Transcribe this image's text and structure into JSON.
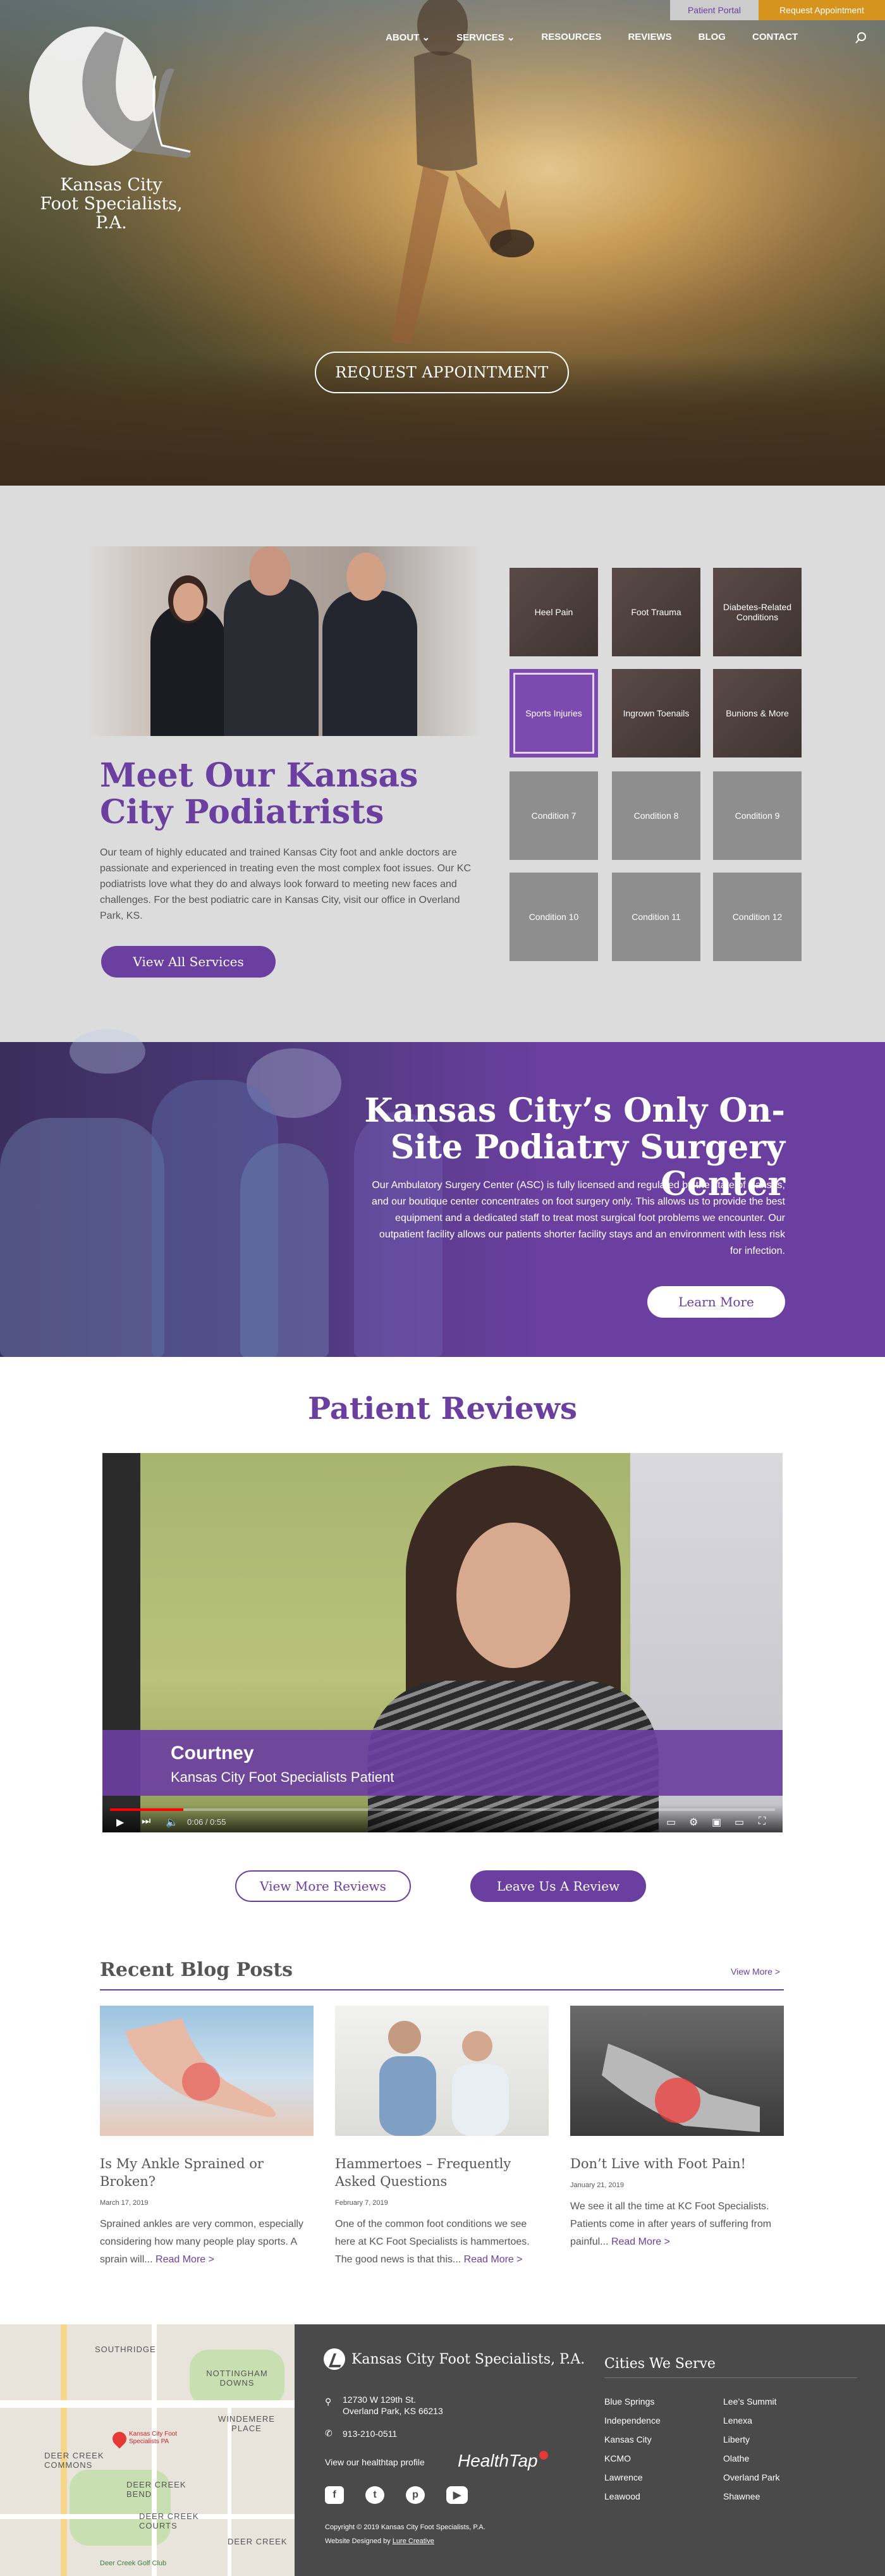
{
  "header": {
    "patient_portal": "Patient Portal",
    "request_appointment": "Request Appointment",
    "nav": [
      "ABOUT",
      "SERVICES",
      "RESOURCES",
      "REVIEWS",
      "BLOG",
      "CONTACT"
    ],
    "logo_line1": "Kansas City",
    "logo_line2": "Foot Specialists, P.A."
  },
  "hero": {
    "cta": "REQUEST APPOINTMENT"
  },
  "meet": {
    "title": "Meet Our Kansas City Podiatrists",
    "text": "Our team of highly educated and trained Kansas City foot and ankle doctors are passionate and experienced in treating even the most complex foot issues. Our KC podiatrists love what they do and always look forward to meeting new faces and challenges. For the best podiatric care in Kansas City, visit our office in Overland Park, KS.",
    "button": "View All Services",
    "conditions": [
      "Heel Pain",
      "Foot Trauma",
      "Diabetes-Related Conditions",
      "Sports Injuries",
      "Ingrown Toenails",
      "Bunions & More",
      "Condition 7",
      "Condition 8",
      "Condition 9",
      "Condition 10",
      "Condition 11",
      "Condition 12"
    ]
  },
  "surgery": {
    "title": "Kansas City’s Only On-Site Podiatry Surgery Center",
    "text": "Our Ambulatory Surgery Center (ASC) is fully licensed and regulated by the state of Kansas, and our boutique center concentrates on foot surgery only. This allows us to provide the best equipment and a dedicated staff to treat most surgical foot problems we encounter. Our outpatient facility allows our patients shorter facility stays and an environment with less risk for infection.",
    "button": "Learn More"
  },
  "reviews": {
    "title": "Patient Reviews",
    "video_name": "Courtney",
    "video_role": "Kansas City Foot Specialists Patient",
    "video_time": "0:06 / 0:55",
    "video_progress": 0.11,
    "view_more": "View More Reviews",
    "leave": "Leave Us A Review"
  },
  "blog": {
    "heading": "Recent Blog Posts",
    "view_more": "View More >",
    "posts": [
      {
        "title": "Is My Ankle Sprained or Broken?",
        "date": "March 17, 2019",
        "excerpt": "Sprained ankles are very common, especially considering how many people play sports. A sprain will...",
        "more": "Read More >"
      },
      {
        "title": "Hammertoes – Frequently Asked Questions",
        "date": "February 7, 2019",
        "excerpt": "One of the common foot conditions we see here at KC Foot Specialists is hammertoes. The good news is that this...",
        "more": "Read More >"
      },
      {
        "title": "Don’t Live with Foot Pain!",
        "date": "January 21, 2019",
        "excerpt": "We see it all the time at KC Foot Specialists. Patients come in after years of suffering from painful...",
        "more": "Read More >"
      }
    ]
  },
  "map": {
    "labels": [
      "SOUTHRIDGE",
      "NOTTINGHAM DOWNS",
      "WINDEMERE PLACE",
      "DEER CREEK COMMONS",
      "DEER CREEK BEND",
      "DEER CREEK COURTS",
      "DEER CREEK"
    ],
    "pin_label": "Kansas City Foot Specialists PA",
    "golf": "Deer Creek Golf Club"
  },
  "footer": {
    "name": "Kansas City Foot Specialists, P.A.",
    "address1": "12730 W 129th St.",
    "address2": "Overland Park, KS 66213",
    "phone": "913-210-0511",
    "healthtap_text": "View our healthtap profile",
    "healthtap_logo": "HealthTap",
    "copyright": "Copyright © 2019 Kansas City Foot Specialists, P.A.",
    "designed_prefix": "Website Designed by",
    "designed_by": "Lure Creative",
    "cities_heading": "Cities We Serve",
    "cities": [
      "Blue Springs",
      "Lee’s Summit",
      "Independence",
      "Lenexa",
      "Kansas City",
      "Liberty",
      "KCMO",
      "Olathe",
      "Lawrence",
      "Overland Park",
      "Leawood",
      "Shawnee"
    ]
  },
  "colors": {
    "purple": "#6b3fa0",
    "gold": "#d6941e",
    "footer": "#4a4a4a"
  }
}
